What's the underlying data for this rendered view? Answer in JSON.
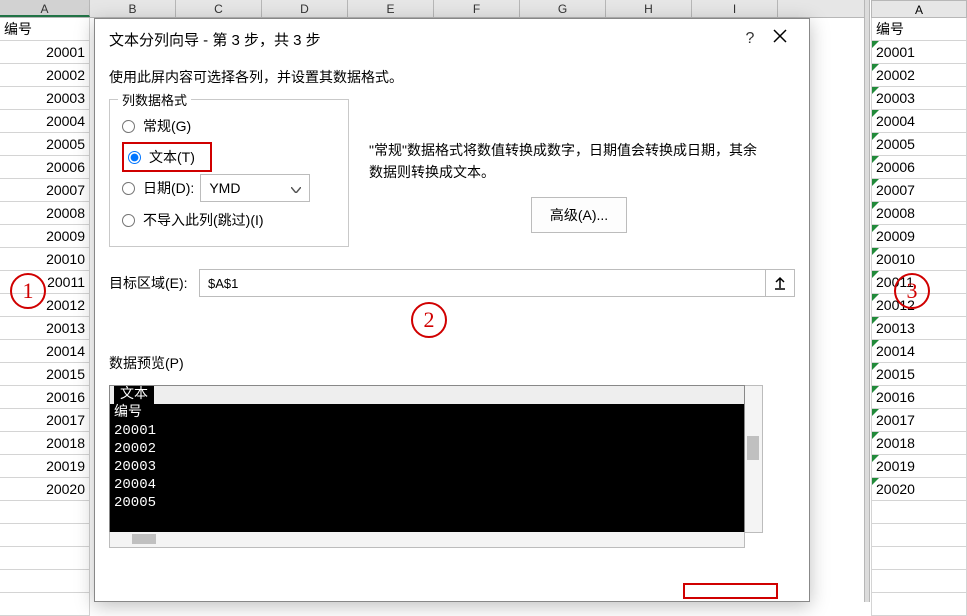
{
  "columns_left": [
    "A",
    "B",
    "C",
    "D",
    "E",
    "F",
    "G",
    "H",
    "I"
  ],
  "column_right": "A",
  "left_sheet": {
    "header": "编号",
    "values": [
      "20001",
      "20002",
      "20003",
      "20004",
      "20005",
      "20006",
      "20007",
      "20008",
      "20009",
      "20010",
      "20011",
      "20012",
      "20013",
      "20014",
      "20015",
      "20016",
      "20017",
      "20018",
      "20019",
      "20020"
    ]
  },
  "right_sheet": {
    "header": "编号",
    "values": [
      "20001",
      "20002",
      "20003",
      "20004",
      "20005",
      "20006",
      "20007",
      "20008",
      "20009",
      "20010",
      "20011",
      "20012",
      "20013",
      "20014",
      "20015",
      "20016",
      "20017",
      "20018",
      "20019",
      "20020"
    ]
  },
  "annotations": {
    "circle1": "1",
    "circle2": "2",
    "circle3": "3"
  },
  "dialog": {
    "title": "文本分列向导 - 第 3 步，共 3 步",
    "help_char": "?",
    "intro": "使用此屏内容可选择各列，并设置其数据格式。",
    "fmt_legend": "列数据格式",
    "radio_general": "常规(G)",
    "radio_text": "文本(T)",
    "radio_date": "日期(D):",
    "radio_skip": "不导入此列(跳过)(I)",
    "date_format": "YMD",
    "desc_line1": "\"常规\"数据格式将数值转换成数字，日期值会转换成日期，其余",
    "desc_line2": "数据则转换成文本。",
    "advanced": "高级(A)...",
    "dest_label": "目标区域(E):",
    "dest_value": "$A$1",
    "preview_label": "数据预览(P)",
    "preview_colhdr": "文本",
    "preview_rows": [
      "编号",
      "20001",
      "20002",
      "20003",
      "20004",
      "20005"
    ]
  }
}
